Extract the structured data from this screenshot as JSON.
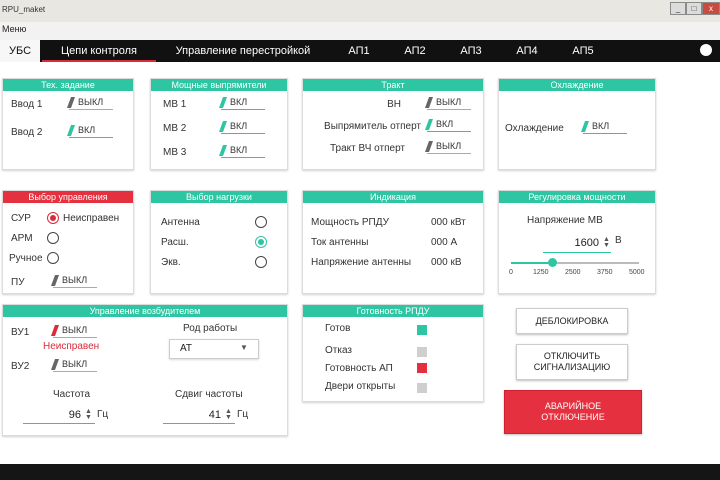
{
  "window": {
    "title": "RPU_maket",
    "min": "_",
    "max": "□",
    "close": "x"
  },
  "menu": {
    "label": "Меню"
  },
  "tabs": [
    {
      "label": "УБС"
    },
    {
      "label": "Цепи контроля"
    },
    {
      "label": "Управление перестройкой"
    },
    {
      "label": "АП1"
    },
    {
      "label": "АП2"
    },
    {
      "label": "АП3"
    },
    {
      "label": "АП4"
    },
    {
      "label": "АП5"
    }
  ],
  "tech": {
    "title": "Тех. задание",
    "rows": [
      {
        "label": "Ввод 1",
        "state": "ВЫКЛ"
      },
      {
        "label": "Ввод 2",
        "state": "ВКЛ"
      }
    ]
  },
  "rectifiers": {
    "title": "Мощные выпрямители",
    "rows": [
      {
        "label": "МВ 1",
        "state": "ВКЛ"
      },
      {
        "label": "МВ 2",
        "state": "ВКЛ"
      },
      {
        "label": "МВ 3",
        "state": "ВКЛ"
      }
    ]
  },
  "tract": {
    "title": "Тракт",
    "rows": [
      {
        "label": "ВН",
        "state": "ВЫКЛ"
      },
      {
        "label": "Выпрямитель отперт",
        "state": "ВКЛ"
      },
      {
        "label": "Тракт ВЧ отперт",
        "state": "ВЫКЛ"
      }
    ]
  },
  "cooling": {
    "title": "Охлаждение",
    "label": "Охлаждение",
    "state": "ВКЛ"
  },
  "control": {
    "title": "Выбор управления",
    "sur": "СУР",
    "sur_status": "Неисправен",
    "arm": "АРМ",
    "manual": "Ручное",
    "pu": "ПУ",
    "pu_state": "ВЫКЛ"
  },
  "load": {
    "title": "Выбор нагрузки",
    "options": [
      {
        "label": "Антенна"
      },
      {
        "label": "Расш."
      },
      {
        "label": "Экв."
      }
    ],
    "selected": "Расш."
  },
  "indication": {
    "title": "Индикация",
    "rows": [
      {
        "label": "Мощность РПДУ",
        "value": "000 кВт"
      },
      {
        "label": "Ток антенны",
        "value": "000 А"
      },
      {
        "label": "Напряжение антенны",
        "value": "000 кВ"
      }
    ]
  },
  "power": {
    "title": "Регулировка мощности",
    "label": "Напряжение МВ",
    "value": "1600",
    "unit": "В",
    "slider_value": 1600,
    "slider_min": 0,
    "slider_max": 5000,
    "ticks": [
      "0",
      "1250",
      "2500",
      "3750",
      "5000"
    ]
  },
  "exciter": {
    "title": "Управление возбудителем",
    "vu1": "ВУ1",
    "vu1_state": "ВЫКЛ",
    "vu1_status": "Неисправен",
    "vu2": "ВУ2",
    "vu2_state": "ВЫКЛ",
    "mode_label": "Род работы",
    "mode_value": "АТ",
    "freq_label": "Частота",
    "freq_value": "96",
    "freq_unit": "Гц",
    "shift_label": "Сдвиг частоты",
    "shift_value": "41",
    "shift_unit": "Гц"
  },
  "readiness": {
    "title": "Готовность РПДУ",
    "rows": [
      {
        "label": "Готов",
        "color": "#2ec5a3"
      },
      {
        "label": "Отказ",
        "color": "#cfcfcf"
      },
      {
        "label": "Готовность АП",
        "color": "#e4303f"
      },
      {
        "label": "Двери открыты",
        "color": "#cfcfcf"
      }
    ]
  },
  "buttons": {
    "unlock": "ДЕБЛОКИРОВКА",
    "alarm_off_1": "ОТКЛЮЧИТЬ",
    "alarm_off_2": "СИГНАЛИЗАЦИЮ",
    "emergency_1": "АВАРИЙНОЕ",
    "emergency_2": "ОТКЛЮЧЕНИЕ"
  },
  "colors": {
    "accent": "#2ec5a3",
    "danger": "#e4303f",
    "tab_bar": "#111111"
  }
}
